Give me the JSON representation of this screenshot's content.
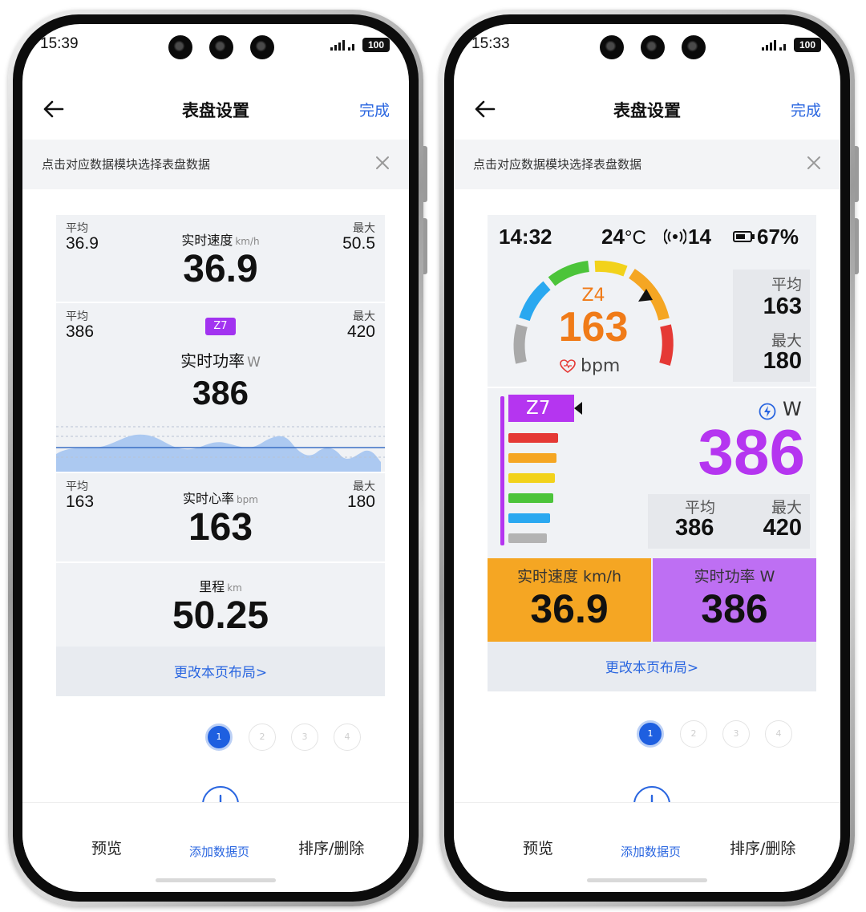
{
  "common": {
    "nav_title": "表盘设置",
    "done_label": "完成",
    "hint_text": "点击对应数据模块选择表盘数据",
    "change_layout": "更改本页布局>",
    "pages": [
      "1",
      "2",
      "3",
      "4"
    ],
    "battery_status": "100",
    "bottom_nav": {
      "preview": "预览",
      "add_page": "添加数据页",
      "sort_delete": "排序/删除"
    }
  },
  "left_phone": {
    "status_time": "15:39",
    "speed": {
      "avg_label": "平均",
      "avg": "36.9",
      "label": "实时速度",
      "unit": "km/h",
      "value": "36.9",
      "max_label": "最大",
      "max": "50.5"
    },
    "power": {
      "avg_label": "平均",
      "avg": "386",
      "zone": "Z7",
      "label": "实时功率",
      "unit": "W",
      "value": "386",
      "max_label": "最大",
      "max": "420"
    },
    "heart_rate": {
      "avg_label": "平均",
      "avg": "163",
      "label": "实时心率",
      "unit": "bpm",
      "value": "163",
      "max_label": "最大",
      "max": "180"
    },
    "distance": {
      "label": "里程",
      "unit": "km",
      "value": "50.25"
    }
  },
  "right_phone": {
    "status_time": "15:33",
    "device_bar": {
      "clock": "14:32",
      "temperature": "24",
      "temp_unit": "°C",
      "satellites": "14",
      "battery": "67%"
    },
    "heart_rate": {
      "zone": "Z4",
      "value": "163",
      "unit": "bpm",
      "avg_label": "平均",
      "avg": "163",
      "max_label": "最大",
      "max": "180"
    },
    "power": {
      "zone": "Z7",
      "unit": "W",
      "value": "386",
      "avg_label": "平均",
      "avg": "386",
      "max_label": "最大",
      "max": "420"
    },
    "tiles": {
      "speed": {
        "label": "实时速度 km/h",
        "value": "36.9"
      },
      "power": {
        "label": "实时功率 W",
        "value": "386"
      }
    },
    "zone_colors": [
      "#e53935",
      "#f5a623",
      "#f2d21b",
      "#4cc43a",
      "#2aa8f0",
      "#b3b3b3"
    ],
    "power_color": "#b535f0",
    "hr_color": "#f07b18"
  }
}
